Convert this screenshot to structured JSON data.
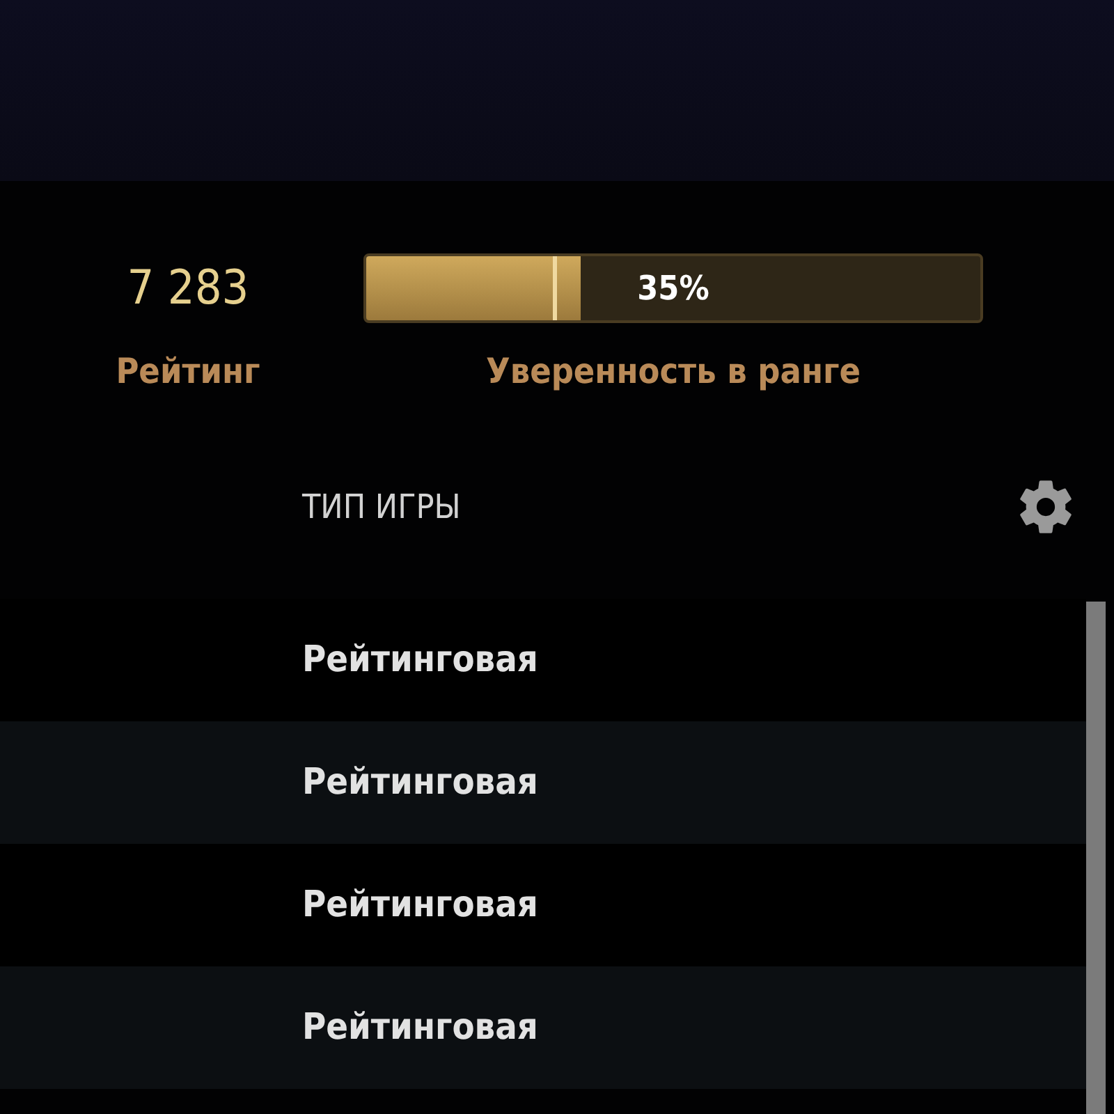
{
  "rating": {
    "value": "7 283",
    "label": "Рейтинг"
  },
  "confidence": {
    "level": 0.35,
    "reading": "35%",
    "label": "Уверенность в ранге"
  },
  "table": {
    "column": "ТИП ИГРЫ",
    "rows": [
      {
        "game_type": "Рейтинговая"
      },
      {
        "game_type": "Рейтинговая"
      },
      {
        "game_type": "Рейтинговая"
      },
      {
        "game_type": "Рейтинговая"
      }
    ]
  }
}
